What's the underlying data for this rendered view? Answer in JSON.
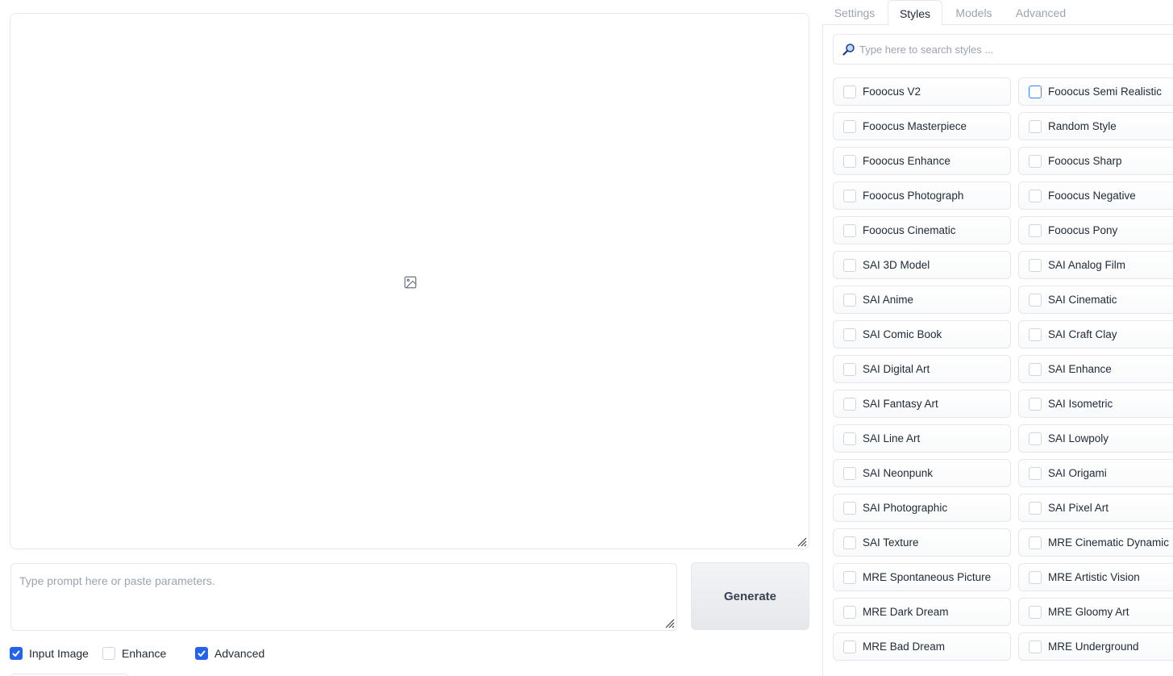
{
  "gallery": {
    "empty_icon": "image-icon"
  },
  "prompt": {
    "placeholder": "Type prompt here or paste parameters.",
    "value": ""
  },
  "generate_label": "Generate",
  "options": [
    {
      "label": "Input Image",
      "checked": true
    },
    {
      "label": "Enhance",
      "checked": false
    },
    {
      "label": "Advanced",
      "checked": true
    }
  ],
  "tabs": [
    {
      "label": "Settings",
      "active": false
    },
    {
      "label": "Styles",
      "active": true
    },
    {
      "label": "Models",
      "active": false
    },
    {
      "label": "Advanced",
      "active": false
    }
  ],
  "search": {
    "placeholder": "Type here to search styles ...",
    "icon": "magnifier-icon"
  },
  "styles": [
    {
      "label": "Fooocus V2",
      "checked": false
    },
    {
      "label": "Fooocus Semi Realistic",
      "checked": false,
      "focused": true
    },
    {
      "label": "Fooocus Masterpiece",
      "checked": false
    },
    {
      "label": "Random Style",
      "checked": false
    },
    {
      "label": "Fooocus Enhance",
      "checked": false
    },
    {
      "label": "Fooocus Sharp",
      "checked": false
    },
    {
      "label": "Fooocus Photograph",
      "checked": false
    },
    {
      "label": "Fooocus Negative",
      "checked": false
    },
    {
      "label": "Fooocus Cinematic",
      "checked": false
    },
    {
      "label": "Fooocus Pony",
      "checked": false
    },
    {
      "label": "SAI 3D Model",
      "checked": false
    },
    {
      "label": "SAI Analog Film",
      "checked": false
    },
    {
      "label": "SAI Anime",
      "checked": false
    },
    {
      "label": "SAI Cinematic",
      "checked": false
    },
    {
      "label": "SAI Comic Book",
      "checked": false
    },
    {
      "label": "SAI Craft Clay",
      "checked": false
    },
    {
      "label": "SAI Digital Art",
      "checked": false
    },
    {
      "label": "SAI Enhance",
      "checked": false
    },
    {
      "label": "SAI Fantasy Art",
      "checked": false
    },
    {
      "label": "SAI Isometric",
      "checked": false
    },
    {
      "label": "SAI Line Art",
      "checked": false
    },
    {
      "label": "SAI Lowpoly",
      "checked": false
    },
    {
      "label": "SAI Neonpunk",
      "checked": false
    },
    {
      "label": "SAI Origami",
      "checked": false
    },
    {
      "label": "SAI Photographic",
      "checked": false
    },
    {
      "label": "SAI Pixel Art",
      "checked": false
    },
    {
      "label": "SAI Texture",
      "checked": false
    },
    {
      "label": "MRE Cinematic Dynamic",
      "checked": false
    },
    {
      "label": "MRE Spontaneous Picture",
      "checked": false
    },
    {
      "label": "MRE Artistic Vision",
      "checked": false
    },
    {
      "label": "MRE Dark Dream",
      "checked": false
    },
    {
      "label": "MRE Gloomy Art",
      "checked": false
    },
    {
      "label": "MRE Bad Dream",
      "checked": false
    },
    {
      "label": "MRE Underground",
      "checked": false
    }
  ],
  "colors": {
    "accent": "#2563eb",
    "border": "#e5e7eb",
    "muted_text": "#9ca3af"
  }
}
